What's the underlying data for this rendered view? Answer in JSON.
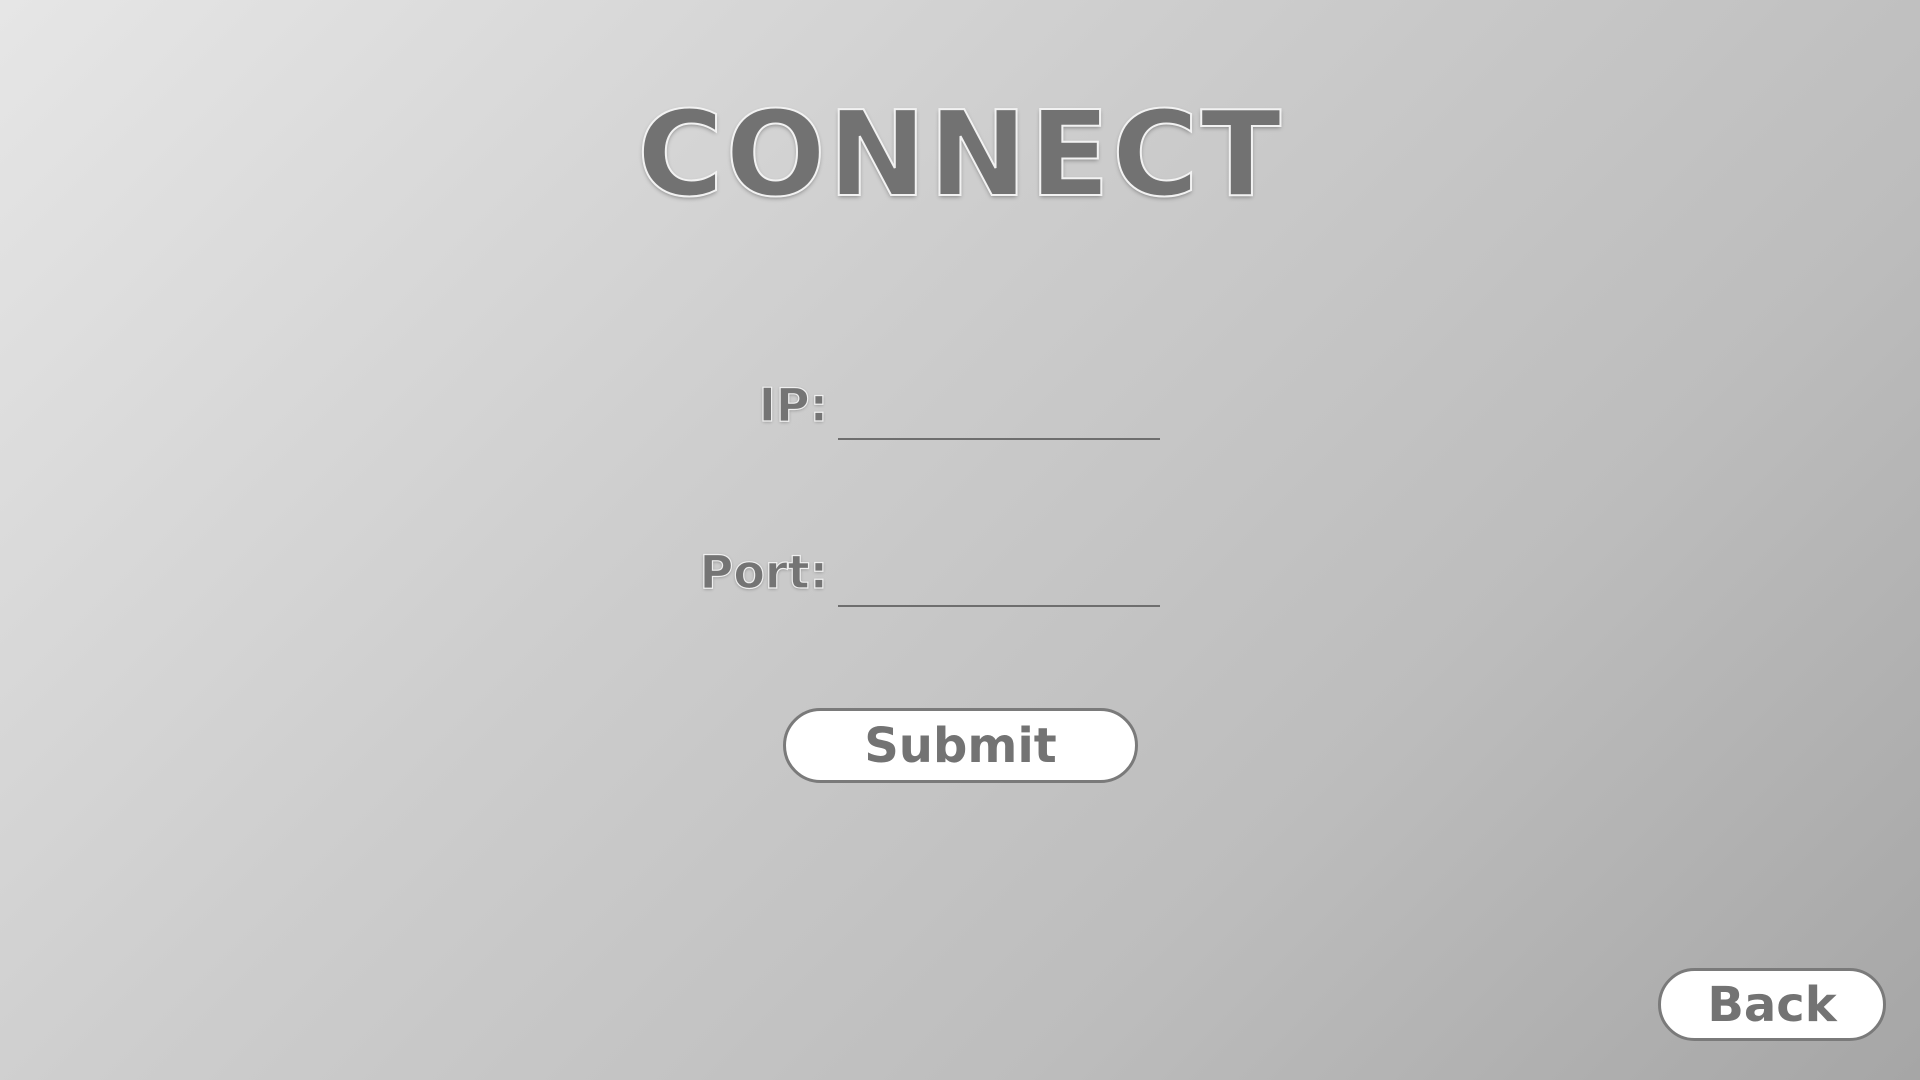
{
  "screen": {
    "title": "CONNECT"
  },
  "form": {
    "ip_label": "IP:",
    "ip_value": "",
    "port_label": "Port:",
    "port_value": "",
    "submit_label": "Submit"
  },
  "navigation": {
    "back_label": "Back"
  },
  "colors": {
    "text": "#737373",
    "button_background": "#ffffff",
    "button_border": "#7a7a7a",
    "underline": "#6e6e6e"
  }
}
